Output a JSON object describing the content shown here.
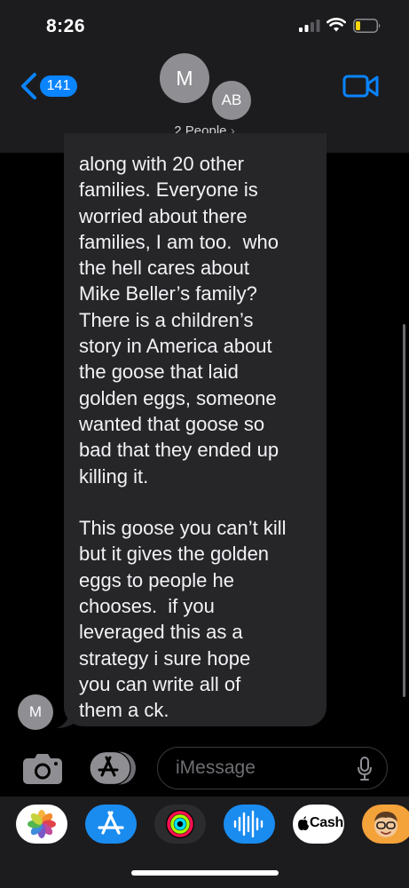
{
  "status": {
    "time": "8:26"
  },
  "header": {
    "back_count": "141",
    "avatar_primary": "M",
    "avatar_secondary": "AB",
    "participants": "2 People",
    "participants_chevron": "›"
  },
  "conversation": {
    "sender_avatar": "M",
    "message": "along with 20 other\nfamilies. Everyone is\nworried about there\nfamilies, I am too.  who\nthe hell cares about\nMike Beller’s family?\nThere is a children’s\nstory in America about\nthe goose that laid\ngolden eggs, someone\nwanted that goose so\nbad that they ended up\nkilling it.\n\nThis goose you can’t kill\nbut it gives the golden\neggs to people he\nchooses.  if you\nleveraged this as a\nstrategy i sure hope\nyou can write all of\nthem a ck."
  },
  "input_bar": {
    "placeholder": "iMessage"
  },
  "app_drawer": {
    "apps": [
      {
        "name": "Photos",
        "icon": "photos-icon"
      },
      {
        "name": "App Store",
        "icon": "app-store-icon"
      },
      {
        "name": "Activity",
        "icon": "activity-rings-icon"
      },
      {
        "name": "Audio",
        "icon": "audio-waveform-icon"
      },
      {
        "name": "Apple Cash",
        "label": "Cash",
        "icon": "apple-cash-icon"
      },
      {
        "name": "Memoji",
        "icon": "memoji-icon"
      }
    ]
  },
  "colors": {
    "accent": "#0a84ff",
    "header_bg": "#1c1c1e",
    "bubble_bg": "#262628",
    "background": "#000000"
  }
}
